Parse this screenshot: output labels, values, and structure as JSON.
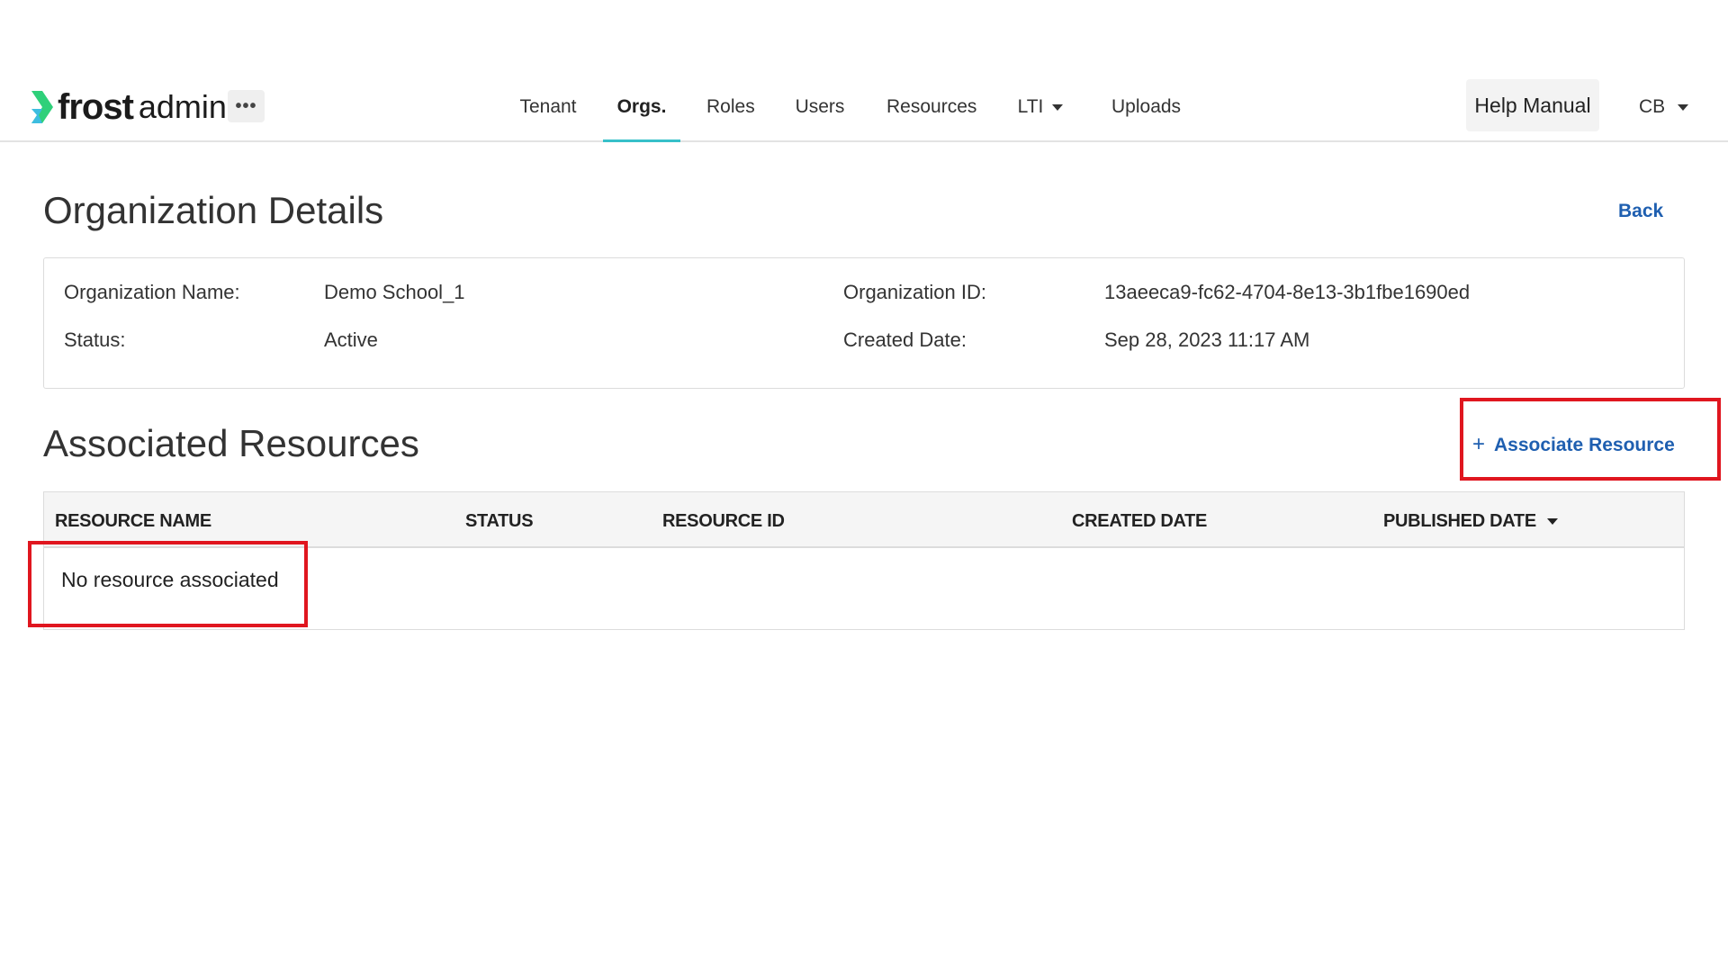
{
  "app": {
    "logo_frost": "frost",
    "logo_admin": "admin",
    "more_label": "•••"
  },
  "nav": {
    "items": [
      {
        "label": "Tenant",
        "active": false
      },
      {
        "label": "Orgs.",
        "active": true
      },
      {
        "label": "Roles",
        "active": false
      },
      {
        "label": "Users",
        "active": false
      },
      {
        "label": "Resources",
        "active": false
      },
      {
        "label": "LTI",
        "active": false,
        "has_dropdown": true
      },
      {
        "label": "Uploads",
        "active": false
      }
    ],
    "help_label": "Help Manual",
    "user_initials": "CB"
  },
  "page": {
    "title": "Organization Details",
    "back_label": "Back"
  },
  "details": {
    "name_label": "Organization Name:",
    "name_value": "Demo School_1",
    "status_label": "Status:",
    "status_value": "Active",
    "id_label": "Organization ID:",
    "id_value": "13aeeca9-fc62-4704-8e13-3b1fbe1690ed",
    "created_label": "Created Date:",
    "created_value": "Sep 28, 2023 11:17 AM"
  },
  "resources": {
    "title": "Associated Resources",
    "associate_plus": "+",
    "associate_label": "Associate Resource",
    "columns": [
      "RESOURCE NAME",
      "STATUS",
      "RESOURCE ID",
      "CREATED DATE",
      "PUBLISHED DATE"
    ],
    "empty_message": "No resource associated"
  },
  "colors": {
    "accent": "#37c0c9",
    "link": "#1f5fb0",
    "highlight": "#e0161f",
    "logo_green": "#2fd07a",
    "logo_teal": "#3dbde0"
  },
  "icons": {
    "logo": "frost-chevron-logo",
    "more": "ellipsis-icon",
    "dropdown": "caret-down-icon",
    "plus": "plus-icon",
    "sort": "sort-desc-icon"
  }
}
